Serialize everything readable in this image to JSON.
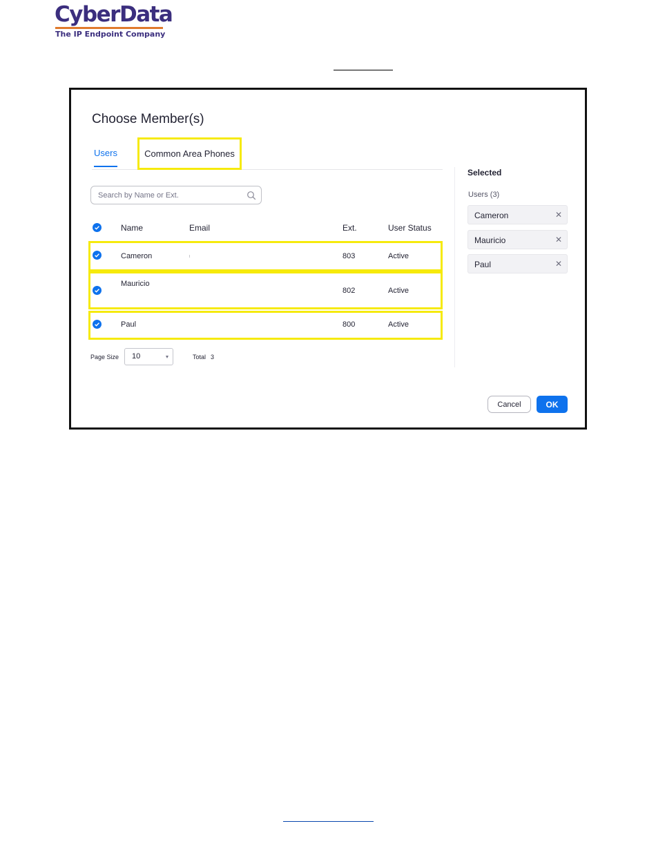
{
  "branding": {
    "logo_name": "CyberData",
    "tagline": "The IP Endpoint Company",
    "colors": {
      "logo_text": "#3b2e7e",
      "logo_bar": "#e07a2c"
    }
  },
  "dialog": {
    "title": "Choose Member(s)",
    "tabs": [
      {
        "label": "Users",
        "active": true
      },
      {
        "label": "Common Area Phones",
        "active": false,
        "highlighted": true
      }
    ],
    "search": {
      "placeholder": "Search by Name or Ext.",
      "value": "",
      "icon": "search-icon"
    },
    "table": {
      "columns": [
        "Name",
        "Email",
        "Ext.",
        "User Status"
      ],
      "select_all_checked": true,
      "rows": [
        {
          "checked": true,
          "name": "Cameron",
          "email": "",
          "ext": "803",
          "status": "Active"
        },
        {
          "checked": true,
          "name": "Mauricio",
          "email": "",
          "ext": "802",
          "status": "Active"
        },
        {
          "checked": true,
          "name": "Paul",
          "email": "",
          "ext": "800",
          "status": "Active"
        }
      ]
    },
    "pagination": {
      "page_size_label": "Page Size",
      "page_size_value": "10",
      "total_label": "Total",
      "total_value": "3"
    },
    "selected_panel": {
      "title": "Selected",
      "group_label": "Users (3)",
      "chips": [
        {
          "label": "Cameron",
          "remove_icon": "close-icon"
        },
        {
          "label": "Mauricio",
          "remove_icon": "close-icon"
        },
        {
          "label": "Paul",
          "remove_icon": "close-icon"
        }
      ]
    },
    "buttons": {
      "cancel": "Cancel",
      "ok": "OK"
    },
    "colors": {
      "accent": "#0e72ed",
      "highlight": "#f6ea0c"
    }
  }
}
